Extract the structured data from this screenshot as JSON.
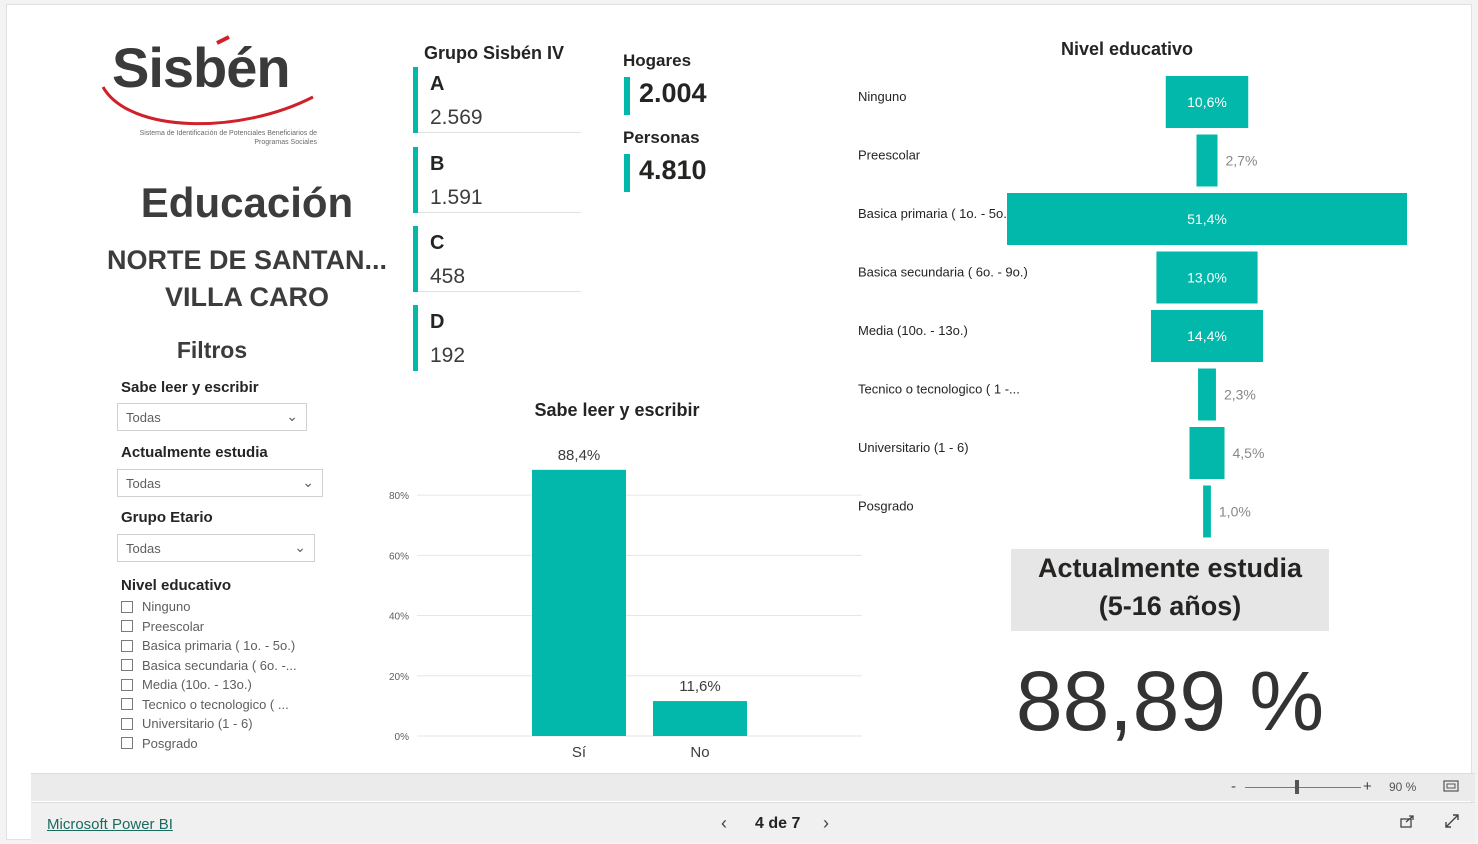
{
  "logo": {
    "word": "Sisbén",
    "tagline": "Sistema de Identificación de Potenciales Beneficiarios de Programas Sociales"
  },
  "header": {
    "title": "Educación",
    "department": "NORTE DE SANTAN...",
    "municipality": "VILLA CARO"
  },
  "filters": {
    "title": "Filtros",
    "sabe_leer": {
      "label": "Sabe leer y escribir",
      "value": "Todas"
    },
    "actualmente_estudia": {
      "label": "Actualmente estudia",
      "value": "Todas"
    },
    "grupo_etario": {
      "label": "Grupo Etario",
      "value": "Todas"
    },
    "nivel_educativo": {
      "label": "Nivel educativo",
      "options": [
        "Ninguno",
        "Preescolar",
        "Basica primaria ( 1o. - 5o.)",
        "Basica secundaria ( 6o. -...",
        "Media (10o. - 13o.)",
        "Tecnico o tecnologico ( ...",
        "Universitario (1 - 6)",
        "Posgrado"
      ]
    }
  },
  "grupo_sisben": {
    "title": "Grupo Sisbén IV",
    "groups": [
      {
        "letter": "A",
        "value": "2.569"
      },
      {
        "letter": "B",
        "value": "1.591"
      },
      {
        "letter": "C",
        "value": "458"
      },
      {
        "letter": "D",
        "value": "192"
      }
    ]
  },
  "kpis": {
    "hogares_label": "Hogares",
    "hogares_value": "2.004",
    "personas_label": "Personas",
    "personas_value": "4.810"
  },
  "colors": {
    "accent": "#01b8aa",
    "grid": "#e6e6e6"
  },
  "chart_data": [
    {
      "type": "bar",
      "title": "Sabe leer y escribir",
      "categories": [
        "Sí",
        "No"
      ],
      "values": [
        88.4,
        11.6
      ],
      "data_labels": [
        "88,4%",
        "11,6%"
      ],
      "yticks": [
        "0%",
        "20%",
        "40%",
        "60%",
        "80%"
      ],
      "ylim": [
        0,
        90
      ],
      "grid": true
    },
    {
      "type": "bar",
      "title": "Nivel educativo",
      "orientation": "funnel",
      "categories": [
        "Ninguno",
        "Preescolar",
        "Basica primaria ( 1o. - 5o.)",
        "Basica secundaria ( 6o. - 9o.)",
        "Media (10o. - 13o.)",
        "Tecnico o tecnologico ( 1 -...",
        "Universitario (1 - 6)",
        "Posgrado"
      ],
      "values": [
        10.6,
        2.7,
        51.4,
        13.0,
        14.4,
        2.3,
        4.5,
        1.0
      ],
      "data_labels": [
        "10,6%",
        "2,7%",
        "51,4%",
        "13,0%",
        "14,4%",
        "2,3%",
        "4,5%",
        "1,0%"
      ]
    }
  ],
  "actualmente_estudia_card": {
    "title_line1": "Actualmente estudia",
    "title_line2": "(5-16 años)",
    "value": "88,89 %"
  },
  "zoom": {
    "minus": "-",
    "plus": "+",
    "level": "90 %"
  },
  "footer": {
    "link": "Microsoft Power BI",
    "page": "4 de 7"
  }
}
